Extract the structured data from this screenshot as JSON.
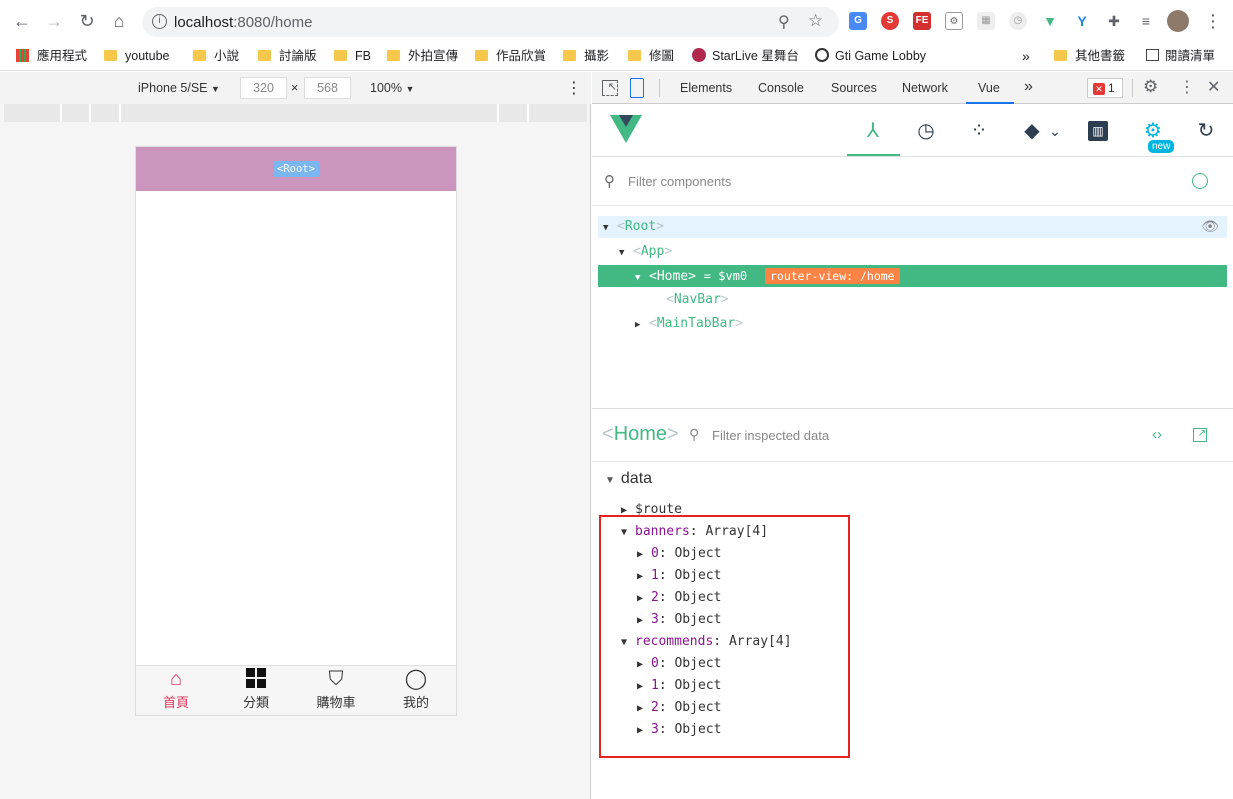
{
  "browser": {
    "url_host": "localhost",
    "url_path": ":8080/home",
    "bookmarks": [
      "應用程式",
      "youtube",
      "小說",
      "討論版",
      "FB",
      "外拍宣傳",
      "作品欣賞",
      "攝影",
      "修圖",
      "StarLive 星舞台",
      "Gti Game Lobby",
      "其他書籤",
      "閱讀清單"
    ]
  },
  "device_toolbar": {
    "device": "iPhone 5/SE",
    "width": "320",
    "height": "568",
    "zoom": "100%"
  },
  "app": {
    "root_tag": "<Root>",
    "tabs": [
      {
        "label": "首頁",
        "icon": "home-icon",
        "active": true
      },
      {
        "label": "分類",
        "icon": "grid-icon",
        "active": false
      },
      {
        "label": "購物車",
        "icon": "cart-icon",
        "active": false
      },
      {
        "label": "我的",
        "icon": "profile-icon",
        "active": false
      }
    ],
    "active_color": "#e0365c"
  },
  "devtools": {
    "tabs": [
      "Elements",
      "Console",
      "Sources",
      "Network",
      "Vue"
    ],
    "active_tab": "Vue",
    "error_count": "1",
    "new_badge": "new",
    "filter_components_placeholder": "Filter components",
    "tree": [
      {
        "name": "Root",
        "depth": 0,
        "expanded": true,
        "selected": false
      },
      {
        "name": "App",
        "depth": 1,
        "expanded": true,
        "selected": false
      },
      {
        "name": "Home",
        "depth": 2,
        "expanded": true,
        "selected": true,
        "vm": "= $vm0",
        "badge": "router-view: /home"
      },
      {
        "name": "NavBar",
        "depth": 3,
        "expanded": false,
        "selected": false,
        "leaf": true
      },
      {
        "name": "MainTabBar",
        "depth": 2,
        "expanded": false,
        "selected": false
      }
    ],
    "inspected_component": "Home",
    "filter_data_placeholder": "Filter inspected data",
    "data_section": "data",
    "data": {
      "route_key": "$route",
      "banners_key": "banners",
      "banners_type": "Array[4]",
      "banners_items": [
        "0",
        "1",
        "2",
        "3"
      ],
      "recommends_key": "recommends",
      "recommends_type": "Array[4]",
      "recommends_items": [
        "0",
        "1",
        "2",
        "3"
      ],
      "item_type": "Object"
    },
    "accent": "#42b983",
    "badge_color": "#ff8344"
  }
}
